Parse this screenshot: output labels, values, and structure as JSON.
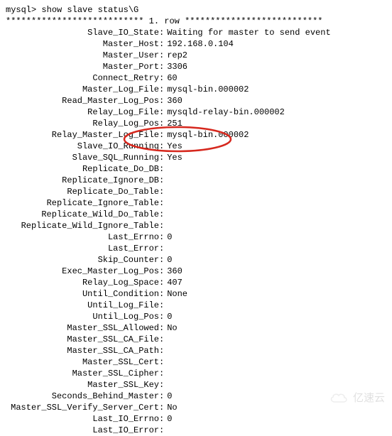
{
  "prompt": "mysql>",
  "command": "show slave status\\G",
  "row_header_left": "***************************",
  "row_header_mid": "1. row",
  "row_header_right": "***************************",
  "sep": ":",
  "fields": [
    {
      "label": "Slave_IO_State",
      "value": "Waiting for master to send event"
    },
    {
      "label": "Master_Host",
      "value": "192.168.0.104"
    },
    {
      "label": "Master_User",
      "value": "rep2"
    },
    {
      "label": "Master_Port",
      "value": "3306"
    },
    {
      "label": "Connect_Retry",
      "value": "60"
    },
    {
      "label": "Master_Log_File",
      "value": "mysql-bin.000002"
    },
    {
      "label": "Read_Master_Log_Pos",
      "value": "360"
    },
    {
      "label": "Relay_Log_File",
      "value": "mysqld-relay-bin.000002"
    },
    {
      "label": "Relay_Log_Pos",
      "value": "251"
    },
    {
      "label": "Relay_Master_Log_File",
      "value": "mysql-bin.000002"
    },
    {
      "label": "Slave_IO_Running",
      "value": "Yes"
    },
    {
      "label": "Slave_SQL_Running",
      "value": "Yes"
    },
    {
      "label": "Replicate_Do_DB",
      "value": ""
    },
    {
      "label": "Replicate_Ignore_DB",
      "value": ""
    },
    {
      "label": "Replicate_Do_Table",
      "value": ""
    },
    {
      "label": "Replicate_Ignore_Table",
      "value": ""
    },
    {
      "label": "Replicate_Wild_Do_Table",
      "value": ""
    },
    {
      "label": "Replicate_Wild_Ignore_Table",
      "value": ""
    },
    {
      "label": "Last_Errno",
      "value": "0"
    },
    {
      "label": "Last_Error",
      "value": ""
    },
    {
      "label": "Skip_Counter",
      "value": "0"
    },
    {
      "label": "Exec_Master_Log_Pos",
      "value": "360"
    },
    {
      "label": "Relay_Log_Space",
      "value": "407"
    },
    {
      "label": "Until_Condition",
      "value": "None"
    },
    {
      "label": "Until_Log_File",
      "value": ""
    },
    {
      "label": "Until_Log_Pos",
      "value": "0"
    },
    {
      "label": "Master_SSL_Allowed",
      "value": "No"
    },
    {
      "label": "Master_SSL_CA_File",
      "value": ""
    },
    {
      "label": "Master_SSL_CA_Path",
      "value": ""
    },
    {
      "label": "Master_SSL_Cert",
      "value": ""
    },
    {
      "label": "Master_SSL_Cipher",
      "value": ""
    },
    {
      "label": "Master_SSL_Key",
      "value": ""
    },
    {
      "label": "Seconds_Behind_Master",
      "value": "0"
    },
    {
      "label": "Master_SSL_Verify_Server_Cert",
      "value": "No"
    },
    {
      "label": "Last_IO_Errno",
      "value": "0"
    },
    {
      "label": "Last_IO_Error",
      "value": ""
    }
  ],
  "watermark": "亿速云"
}
